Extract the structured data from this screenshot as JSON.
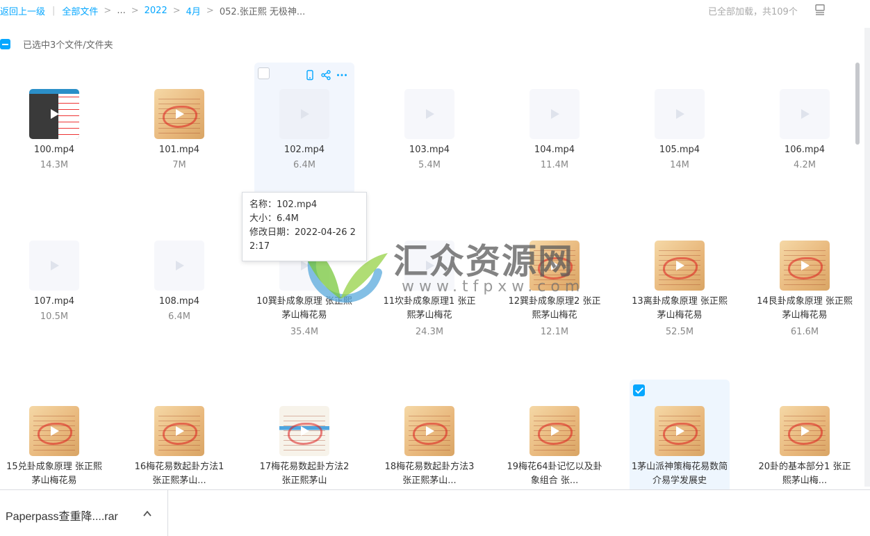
{
  "breadcrumb": {
    "back": "返回上一级",
    "items": [
      "全部文件",
      "...",
      "2022",
      "4月",
      "052.张正熙 无极神..."
    ]
  },
  "load_status": "已全部加载，共109个",
  "selection": {
    "label": "已选中3个文件/文件夹"
  },
  "files": [
    {
      "name": "100.mp4",
      "size": "14.3M"
    },
    {
      "name": "101.mp4",
      "size": "7M"
    },
    {
      "name": "102.mp4",
      "size": "6.4M"
    },
    {
      "name": "103.mp4",
      "size": "5.4M"
    },
    {
      "name": "104.mp4",
      "size": "11.4M"
    },
    {
      "name": "105.mp4",
      "size": "14M"
    },
    {
      "name": "106.mp4",
      "size": "4.2M"
    },
    {
      "name": "107.mp4",
      "size": "10.5M"
    },
    {
      "name": "108.mp4",
      "size": "6.4M"
    },
    {
      "name": "10巽卦成象原理 张正熙茅山梅花易",
      "size": "35.4M"
    },
    {
      "name": "11坎卦成象原理1 张正熙茅山梅花",
      "size": "24.3M"
    },
    {
      "name": "12巽卦成象原理2 张正熙茅山梅花",
      "size": "12.1M"
    },
    {
      "name": "13离卦成象原理 张正熙茅山梅花易",
      "size": "52.5M"
    },
    {
      "name": "14艮卦成象原理 张正熙茅山梅花易",
      "size": "61.6M"
    },
    {
      "name": "15兑卦成象原理 张正熙茅山梅花易",
      "size": ""
    },
    {
      "name": "16梅花易数起卦方法1 张正熙茅山...",
      "size": ""
    },
    {
      "name": "17梅花易数起卦方法2 张正熙茅山",
      "size": ""
    },
    {
      "name": "18梅花易数起卦方法3 张正熙茅山...",
      "size": ""
    },
    {
      "name": "19梅花64卦记忆以及卦象组合 张...",
      "size": ""
    },
    {
      "name": "1茅山派神策梅花易数简介易学发展史",
      "size": ""
    },
    {
      "name": "20卦的基本部分1 张正熙茅山梅...",
      "size": ""
    }
  ],
  "tooltip": {
    "name": "名称：102.mp4",
    "size": "大小：6.4M",
    "modified": "修改日期：2022-04-26 22:17"
  },
  "watermark": {
    "title": "汇众资源网",
    "url": "www.tfpxw.com"
  },
  "downloads": {
    "file": "Paperpass查重降....rar"
  },
  "colors": {
    "accent": "#06a7ff"
  }
}
